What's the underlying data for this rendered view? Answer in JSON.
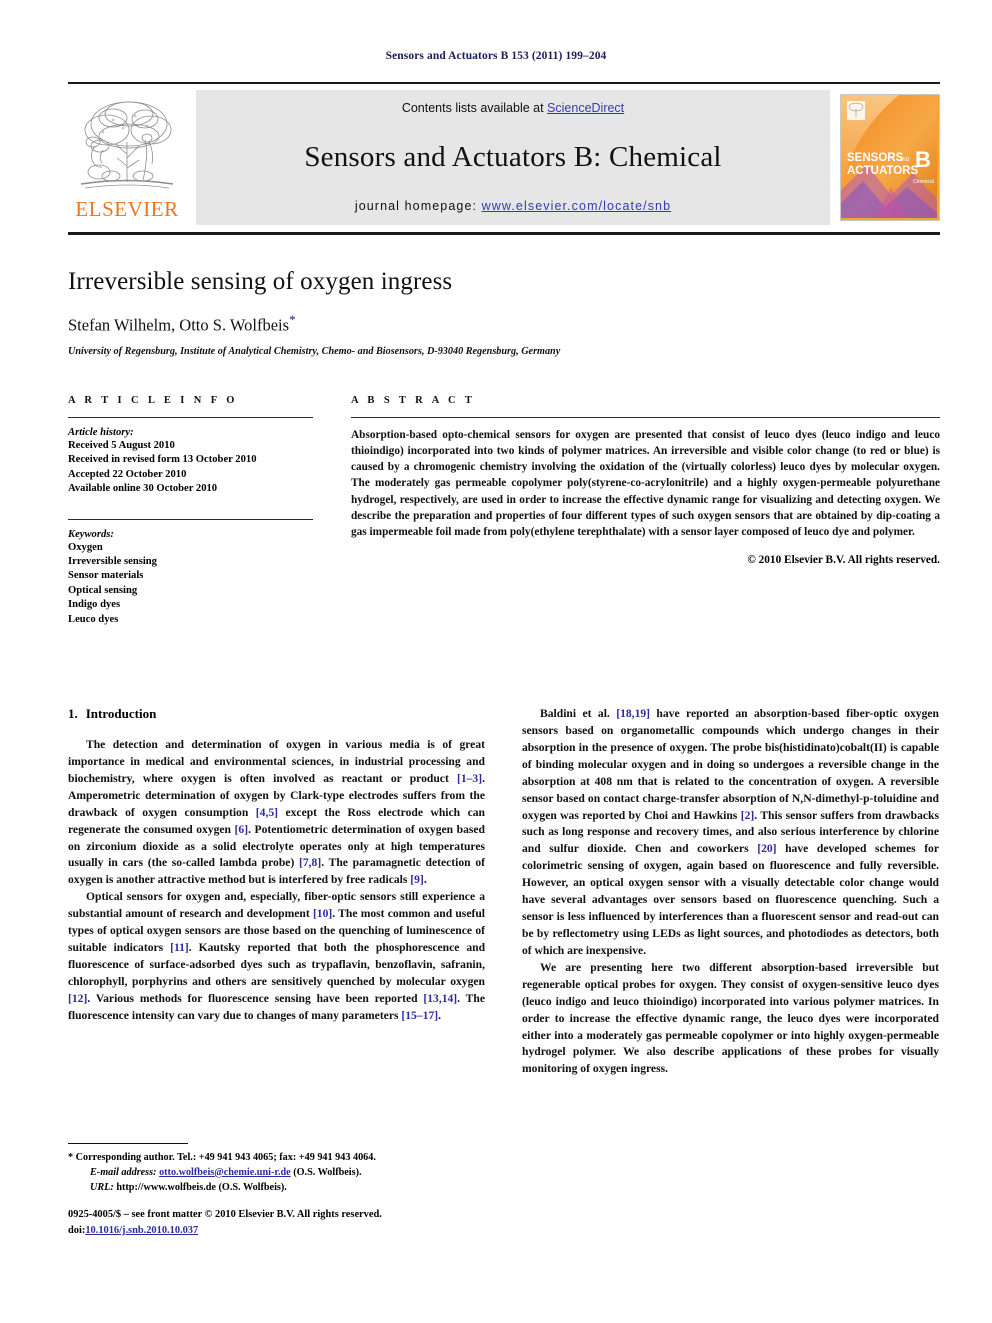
{
  "running_head": "Sensors and Actuators B 153 (2011) 199–204",
  "masthead": {
    "contents_prefix": "Contents lists available at ",
    "sciencedirect": "ScienceDirect",
    "journal_title": "Sensors and Actuators B: Chemical",
    "homepage_prefix": "journal homepage: ",
    "homepage_url": "www.elsevier.com/locate/snb",
    "publisher": "ELSEVIER",
    "cover": {
      "line1": "SENSORS",
      "line1_suffix": "and",
      "line2": "ACTUATORS",
      "letter": "B",
      "sub": "Chemical"
    },
    "colors": {
      "link": "#3a3ab0",
      "elsevier_orange": "#E87722",
      "band_gray": "#e6e6e6",
      "cover_orange": "#f5a623"
    }
  },
  "title_block": {
    "title": "Irreversible sensing of oxygen ingress",
    "authors": "Stefan Wilhelm, Otto S. Wolfbeis",
    "corresponding_marker": "*",
    "affiliation": "University of Regensburg, Institute of Analytical Chemistry, Chemo- and Biosensors, D-93040 Regensburg, Germany"
  },
  "article_info": {
    "heading": "A R T I C L E   I N F O",
    "history_label": "Article history:",
    "history": [
      "Received 5 August 2010",
      "Received in revised form 13 October 2010",
      "Accepted 22 October 2010",
      "Available online 30 October 2010"
    ],
    "keywords_label": "Keywords:",
    "keywords": [
      "Oxygen",
      "Irreversible sensing",
      "Sensor materials",
      "Optical sensing",
      "Indigo dyes",
      "Leuco dyes"
    ]
  },
  "abstract": {
    "heading": "A B S T R A C T",
    "text": "Absorption-based opto-chemical sensors for oxygen are presented that consist of leuco dyes (leuco indigo and leuco thioindigo) incorporated into two kinds of polymer matrices. An irreversible and visible color change (to red or blue) is caused by a chromogenic chemistry involving the oxidation of the (virtually colorless) leuco dyes by molecular oxygen. The moderately gas permeable copolymer poly(styrene-co-acrylonitrile) and a highly oxygen-permeable polyurethane hydrogel, respectively, are used in order to increase the effective dynamic range for visualizing and detecting oxygen. We describe the preparation and properties of four different types of such oxygen sensors that are obtained by dip-coating a gas impermeable foil made from poly(ethylene terephthalate) with a sensor layer composed of leuco dye and polymer.",
    "copyright": "© 2010 Elsevier B.V. All rights reserved."
  },
  "body": {
    "section_number": "1.",
    "section_name": "Introduction",
    "left_paragraphs": [
      "The detection and determination of oxygen in various media is of great importance in medical and environmental sciences, in industrial processing and biochemistry, where oxygen is often involved as reactant or product [1–3]. Amperometric determination of oxygen by Clark-type electrodes suffers from the drawback of oxygen consumption [4,5] except the Ross electrode which can regenerate the consumed oxygen [6]. Potentiometric determination of oxygen based on zirconium dioxide as a solid electrolyte operates only at high temperatures usually in cars (the so-called lambda probe) [7,8]. The paramagnetic detection of oxygen is another attractive method but is interfered by free radicals [9].",
      "Optical sensors for oxygen and, especially, fiber-optic sensors still experience a substantial amount of research and development [10]. The most common and useful types of optical oxygen sensors are those based on the quenching of luminescence of suitable indicators [11]. Kautsky reported that both the phosphorescence and fluorescence of surface-adsorbed dyes such as trypaflavin, benzoflavin, safranin, chlorophyll, porphyrins and others are sensitively quenched by molecular oxygen [12]. Various methods for fluorescence sensing have been reported [13,14]. The fluorescence intensity can vary due to changes of many parameters [15–17]."
    ],
    "right_paragraphs": [
      "Baldini et al. [18,19] have reported an absorption-based fiber-optic oxygen sensors based on organometallic compounds which undergo changes in their absorption in the presence of oxygen. The probe bis(histidinato)cobalt(II) is capable of binding molecular oxygen and in doing so undergoes a reversible change in the absorption at 408 nm that is related to the concentration of oxygen. A reversible sensor based on contact charge-transfer absorption of N,N-dimethyl-p-toluidine and oxygen was reported by Choi and Hawkins [2]. This sensor suffers from drawbacks such as long response and recovery times, and also serious interference by chlorine and sulfur dioxide. Chen and coworkers [20] have developed schemes for colorimetric sensing of oxygen, again based on fluorescence and fully reversible. However, an optical oxygen sensor with a visually detectable color change would have several advantages over sensors based on fluorescence quenching. Such a sensor is less influenced by interferences than a fluorescent sensor and read-out can be by reflectometry using LEDs as light sources, and photodiodes as detectors, both of which are inexpensive.",
      "We are presenting here two different absorption-based irreversible but regenerable optical probes for oxygen. They consist of oxygen-sensitive leuco dyes (leuco indigo and leuco thioindigo) incorporated into various polymer matrices. In order to increase the effective dynamic range, the leuco dyes were incorporated either into a moderately gas permeable copolymer or into highly oxygen-permeable hydrogel polymer. We also describe applications of these probes for visually monitoring of oxygen ingress."
    ]
  },
  "footnote": {
    "marker": "*",
    "corresponding": "Corresponding author. Tel.: +49 941 943 4065; fax: +49 941 943 4064.",
    "email_label": "E-mail address:",
    "email": "otto.wolfbeis@chemie.uni-r.de",
    "email_suffix": "(O.S. Wolfbeis).",
    "url_label": "URL:",
    "url": "http://www.wolfbeis.de",
    "url_suffix": "(O.S. Wolfbeis)."
  },
  "imprint": {
    "front_matter": "0925-4005/$ – see front matter © 2010 Elsevier B.V. All rights reserved.",
    "doi_label": "doi:",
    "doi": "10.1016/j.snb.2010.10.037"
  }
}
